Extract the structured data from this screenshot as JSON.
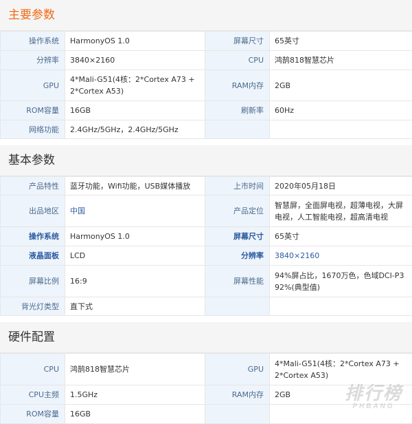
{
  "sections": [
    {
      "title": "主要参数",
      "rows": [
        {
          "l1": "操作系统",
          "v1": "HarmonyOS 1.0",
          "l2": "屏幕尺寸",
          "v2": "65英寸"
        },
        {
          "l1": "分辨率",
          "v1": "3840×2160",
          "l2": "CPU",
          "v2": "鸿鹄818智慧芯片"
        },
        {
          "l1": "GPU",
          "v1": "4*Mali-G51(4核：2*Cortex A73 + 2*Cortex A53)",
          "l2": "RAM内存",
          "v2": "2GB"
        },
        {
          "l1": "ROM容量",
          "v1": "16GB",
          "l2": "刷新率",
          "v2": "60Hz"
        },
        {
          "l1": "网络功能",
          "v1": "2.4GHz/5GHz，2.4GHz/5GHz",
          "l2": "",
          "v2": ""
        }
      ]
    },
    {
      "title": "基本参数",
      "rows": [
        {
          "l1": "产品特性",
          "v1": "蓝牙功能，Wifi功能，USB媒体播放",
          "l2": "上市时间",
          "v2": "2020年05月18日"
        },
        {
          "l1": "出品地区",
          "v1": "中国",
          "l2": "产品定位",
          "v2": "智慧屏，全面屏电视，超薄电视，大屏电视，人工智能电视，超高清电视"
        },
        {
          "l1": "操作系统",
          "v1": "HarmonyOS 1.0",
          "l2": "屏幕尺寸",
          "v2": "65英寸"
        },
        {
          "l1": "液晶面板",
          "v1": "LCD",
          "l2": "分辨率",
          "v2": "3840×2160"
        },
        {
          "l1": "屏幕比例",
          "v1": "16:9",
          "l2": "屏幕性能",
          "v2": "94%屏占比，1670万色，色域DCI-P3 92%(典型值)"
        },
        {
          "l1": "背光灯类型",
          "v1": "直下式",
          "l2": "",
          "v2": ""
        }
      ]
    },
    {
      "title": "硬件配置",
      "rows": [
        {
          "l1": "CPU",
          "v1": "鸿鹄818智慧芯片",
          "l2": "GPU",
          "v2": "4*Mali-G51(4核：2*Cortex A73 + 2*Cortex A53)"
        },
        {
          "l1": "CPU主频",
          "v1": "1.5GHz",
          "l2": "RAM内存",
          "v2": "2GB"
        },
        {
          "l1": "ROM容量",
          "v1": "16GB",
          "l2": "",
          "v2": ""
        }
      ]
    }
  ],
  "watermark": {
    "logo": "排行榜",
    "sub": "PHBANG"
  },
  "colors": {
    "accent": "#f06a14",
    "label_bg": "#eef4fb",
    "label_text": "#4a6a8f",
    "link_blue": "#2a5aa0",
    "border": "#e6e6e6"
  }
}
